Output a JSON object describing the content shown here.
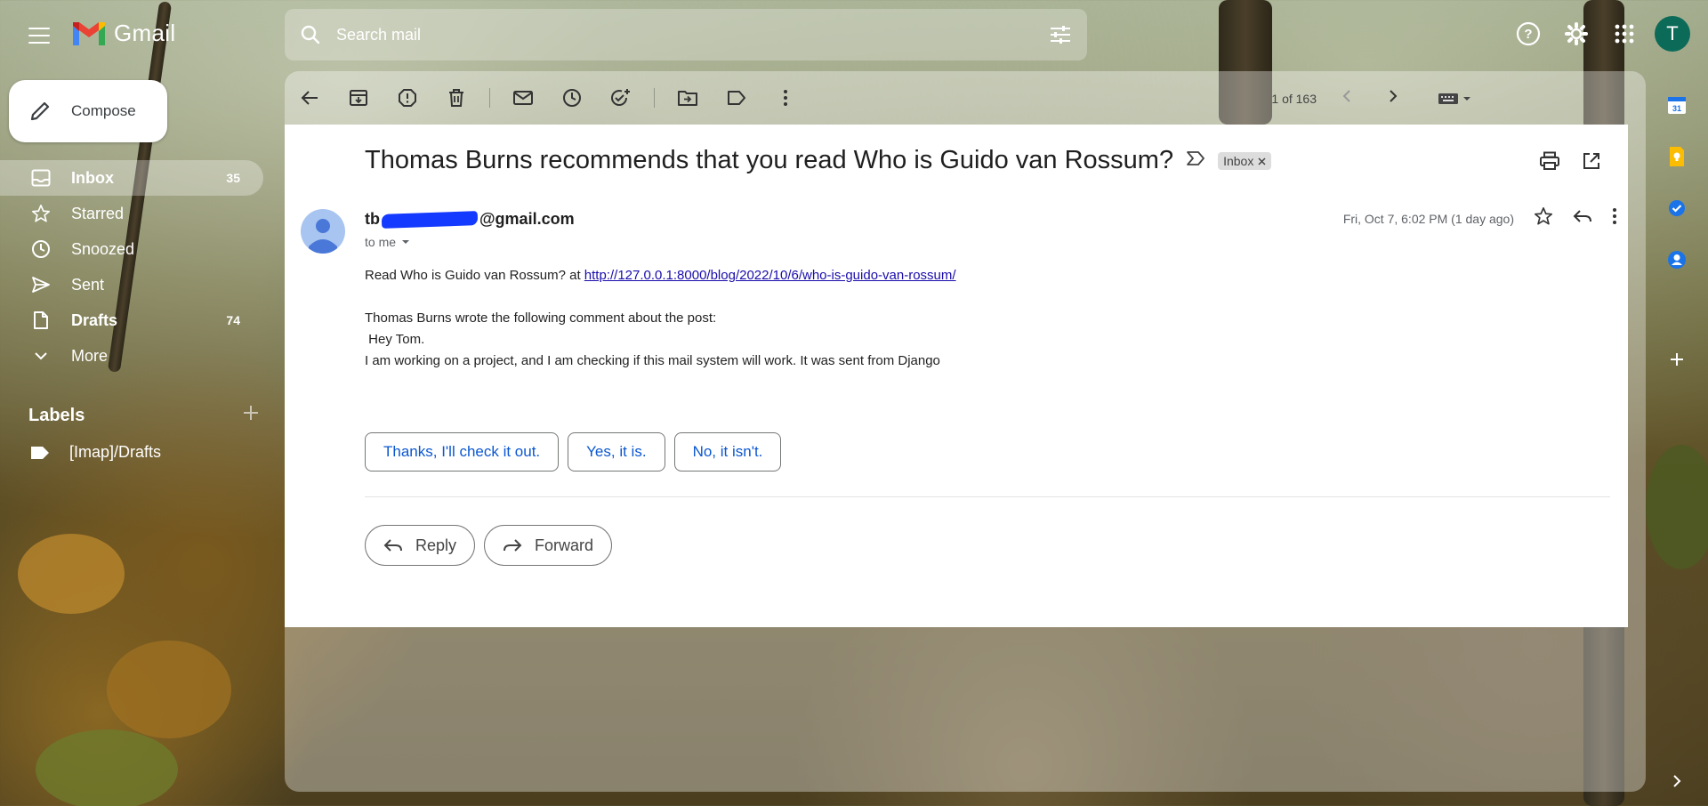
{
  "app": {
    "name": "Gmail"
  },
  "search": {
    "placeholder": "Search mail"
  },
  "user": {
    "initial": "T"
  },
  "compose": {
    "label": "Compose"
  },
  "nav": [
    {
      "label": "Inbox",
      "count": "35",
      "icon": "inbox-icon"
    },
    {
      "label": "Starred",
      "count": "",
      "icon": "star-icon"
    },
    {
      "label": "Snoozed",
      "count": "",
      "icon": "clock-icon"
    },
    {
      "label": "Sent",
      "count": "",
      "icon": "send-icon"
    },
    {
      "label": "Drafts",
      "count": "74",
      "icon": "draft-icon"
    },
    {
      "label": "More",
      "count": "",
      "icon": "chevron-down-icon"
    }
  ],
  "labels": {
    "title": "Labels",
    "items": [
      {
        "label": "[Imap]/Drafts"
      }
    ]
  },
  "pager": {
    "text": "1 of 163"
  },
  "email": {
    "subject": "Thomas Burns recommends that you read Who is Guido van Rossum?",
    "chip": "Inbox",
    "sender_prefix": "tb",
    "sender_suffix": "@gmail.com",
    "to": "to me",
    "date": "Fri, Oct 7, 6:02 PM (1 day ago)",
    "line1_text": "Read Who is Guido van Rossum? at ",
    "line1_link": "http://127.0.0.1:8000/blog/2022/10/6/who-is-guido-van-rossum/",
    "line2": "Thomas Burns wrote the following comment about the post:",
    "line3": " Hey Tom.",
    "line4": "I am working on a project, and I am checking if this mail system will work. It was sent from Django"
  },
  "smart_replies": [
    "Thanks, I'll check it out.",
    "Yes, it is.",
    "No, it isn't."
  ],
  "actions": {
    "reply": "Reply",
    "forward": "Forward"
  },
  "colors": {
    "accent": "#0b57d0",
    "avatar": "#0c6b58",
    "link": "#1a0dab"
  }
}
